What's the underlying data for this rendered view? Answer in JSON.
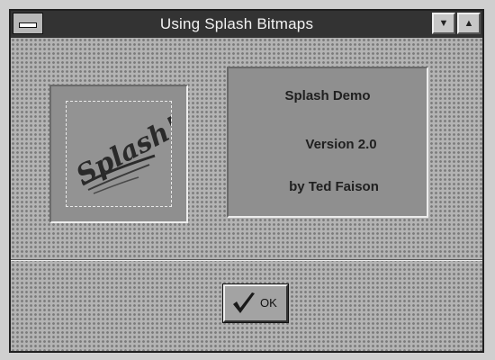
{
  "window": {
    "title": "Using Splash Bitmaps",
    "min_glyph": "▼",
    "max_glyph": "▲"
  },
  "splash_image": {
    "text": "Splash!"
  },
  "info": {
    "line1": "Splash Demo",
    "line2": "Version 2.0",
    "line3": "by Ted Faison"
  },
  "ok_button": {
    "label": "OK"
  },
  "colors": {
    "titlebar": "#333333",
    "pattern": "#7a7a7a",
    "panel": "#8f8f8f"
  }
}
